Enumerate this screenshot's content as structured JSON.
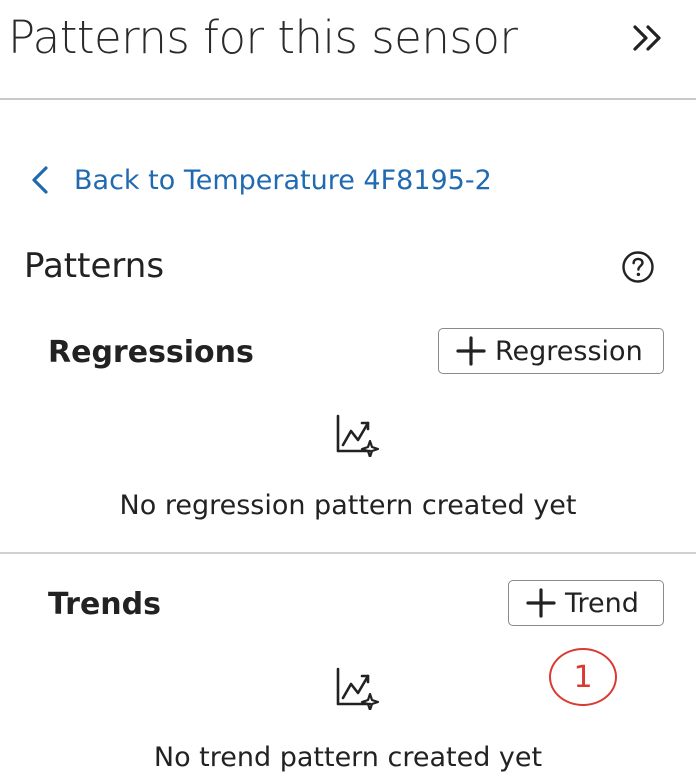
{
  "header": {
    "title": "Patterns for this sensor",
    "collapse_icon": "double-chevron-right-icon"
  },
  "back_link": {
    "label": "Back to Temperature 4F8195-2",
    "color": "#1f6ab0"
  },
  "patterns": {
    "title": "Patterns",
    "help_icon": "help-circle-icon"
  },
  "regressions": {
    "title": "Regressions",
    "add_label": "Regression",
    "empty_icon": "chart-sparkle-icon",
    "empty_text": "No regression pattern created yet"
  },
  "trends": {
    "title": "Trends",
    "add_label": "Trend",
    "empty_icon": "chart-sparkle-icon",
    "empty_text": "No trend pattern created yet"
  },
  "annotation": {
    "marker": "1",
    "color": "#d93a32"
  }
}
